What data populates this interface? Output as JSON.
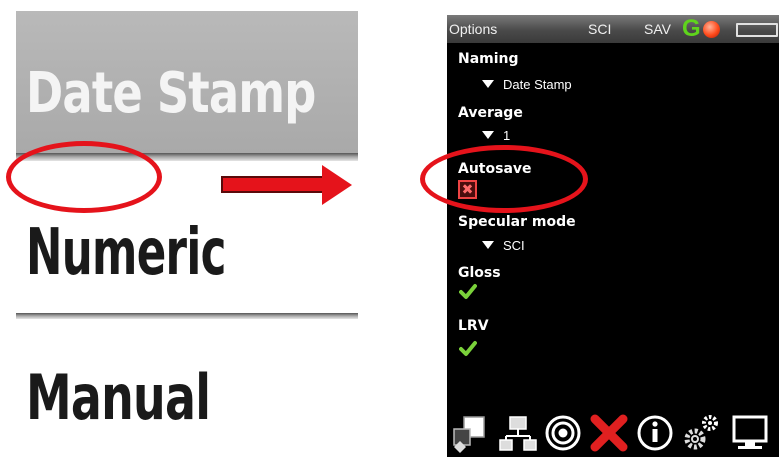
{
  "zoom_list": {
    "items": [
      {
        "label": "Date Stamp",
        "state": "selected"
      },
      {
        "label": "Numeric",
        "state": "normal"
      },
      {
        "label": "Manual",
        "state": "normal"
      }
    ]
  },
  "status_bar": {
    "title": "Options",
    "mode": "SCI",
    "save_status": "SAV",
    "g_indicator": "G",
    "g_color": "#5fd41c",
    "led_color": "#ff4a1a"
  },
  "options": {
    "naming": {
      "label": "Naming",
      "value": "Date Stamp"
    },
    "average": {
      "label": "Average",
      "value": "1"
    },
    "autosave": {
      "label": "Autosave",
      "checked": false,
      "mark": "✖"
    },
    "specular_mode": {
      "label": "Specular mode",
      "value": "SCI"
    },
    "gloss": {
      "label": "Gloss",
      "checked": true
    },
    "lrv": {
      "label": "LRV",
      "checked": true
    }
  },
  "toolbar": {
    "icons": [
      "shapes-icon",
      "network-icon",
      "target-icon",
      "tools-icon",
      "info-icon",
      "settings-icon",
      "monitor-icon"
    ]
  },
  "highlight_color": "#e5131b"
}
